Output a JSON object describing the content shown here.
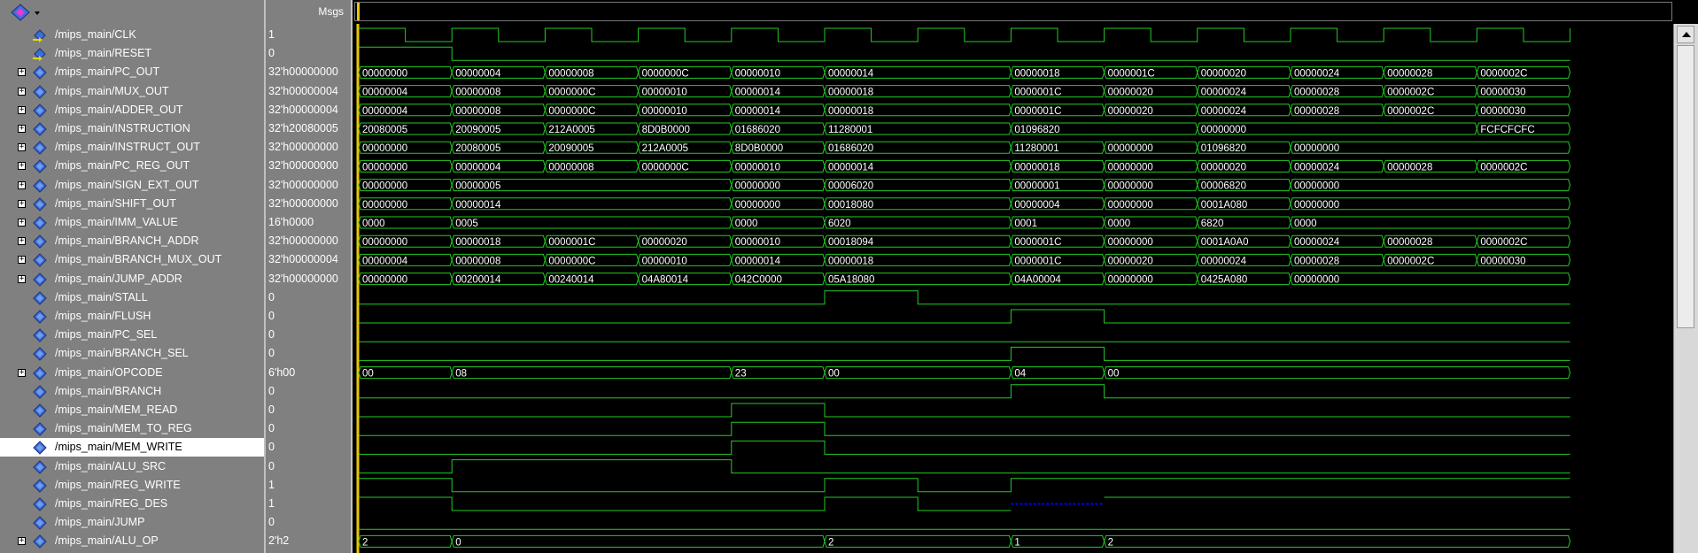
{
  "header": {
    "msgs_label": "Msgs"
  },
  "colors": {
    "wave": "#22cc22",
    "background": "#000000",
    "cursor": "#e8c800",
    "pane": "#808080",
    "highlight": "#0000ff"
  },
  "signals": [
    {
      "name": "/mips_main/CLK",
      "value": "1",
      "kind": "input",
      "expandable": false
    },
    {
      "name": "/mips_main/RESET",
      "value": "0",
      "kind": "input",
      "expandable": false
    },
    {
      "name": "/mips_main/PC_OUT",
      "value": "32'h00000000",
      "kind": "bus",
      "expandable": true
    },
    {
      "name": "/mips_main/MUX_OUT",
      "value": "32'h00000004",
      "kind": "bus",
      "expandable": true
    },
    {
      "name": "/mips_main/ADDER_OUT",
      "value": "32'h00000004",
      "kind": "bus",
      "expandable": true
    },
    {
      "name": "/mips_main/INSTRUCTION",
      "value": "32'h20080005",
      "kind": "bus",
      "expandable": true
    },
    {
      "name": "/mips_main/INSTRUCT_OUT",
      "value": "32'h00000000",
      "kind": "bus",
      "expandable": true
    },
    {
      "name": "/mips_main/PC_REG_OUT",
      "value": "32'h00000000",
      "kind": "bus",
      "expandable": true
    },
    {
      "name": "/mips_main/SIGN_EXT_OUT",
      "value": "32'h00000000",
      "kind": "bus",
      "expandable": true
    },
    {
      "name": "/mips_main/SHIFT_OUT",
      "value": "32'h00000000",
      "kind": "bus",
      "expandable": true
    },
    {
      "name": "/mips_main/IMM_VALUE",
      "value": "16'h0000",
      "kind": "bus",
      "expandable": true
    },
    {
      "name": "/mips_main/BRANCH_ADDR",
      "value": "32'h00000000",
      "kind": "bus",
      "expandable": true
    },
    {
      "name": "/mips_main/BRANCH_MUX_OUT",
      "value": "32'h00000004",
      "kind": "bus",
      "expandable": true
    },
    {
      "name": "/mips_main/JUMP_ADDR",
      "value": "32'h00000000",
      "kind": "bus",
      "expandable": true
    },
    {
      "name": "/mips_main/STALL",
      "value": "0",
      "kind": "bit",
      "expandable": false
    },
    {
      "name": "/mips_main/FLUSH",
      "value": "0",
      "kind": "bit",
      "expandable": false
    },
    {
      "name": "/mips_main/PC_SEL",
      "value": "0",
      "kind": "bit",
      "expandable": false
    },
    {
      "name": "/mips_main/BRANCH_SEL",
      "value": "0",
      "kind": "bit",
      "expandable": false
    },
    {
      "name": "/mips_main/OPCODE",
      "value": "6'h00",
      "kind": "bus",
      "expandable": true
    },
    {
      "name": "/mips_main/BRANCH",
      "value": "0",
      "kind": "bit",
      "expandable": false
    },
    {
      "name": "/mips_main/MEM_READ",
      "value": "0",
      "kind": "bit",
      "expandable": false
    },
    {
      "name": "/mips_main/MEM_TO_REG",
      "value": "0",
      "kind": "bit",
      "expandable": false
    },
    {
      "name": "/mips_main/MEM_WRITE",
      "value": "0",
      "kind": "bit",
      "expandable": false,
      "selected": true
    },
    {
      "name": "/mips_main/ALU_SRC",
      "value": "0",
      "kind": "bit",
      "expandable": false
    },
    {
      "name": "/mips_main/REG_WRITE",
      "value": "1",
      "kind": "bit",
      "expandable": false
    },
    {
      "name": "/mips_main/REG_DES",
      "value": "1",
      "kind": "bit",
      "expandable": false
    },
    {
      "name": "/mips_main/JUMP",
      "value": "0",
      "kind": "bit",
      "expandable": false
    },
    {
      "name": "/mips_main/ALU_OP",
      "value": "2'h2",
      "kind": "bus",
      "expandable": true
    }
  ],
  "waves": {
    "clock_half_periods": 26,
    "timeline_cycles": 13,
    "buses": [
      {
        "row": 2,
        "segments": [
          {
            "c": 0,
            "v": "00000000"
          },
          {
            "c": 1,
            "v": "00000004"
          },
          {
            "c": 2,
            "v": "00000008"
          },
          {
            "c": 3,
            "v": "0000000C"
          },
          {
            "c": 4,
            "v": "00000010"
          },
          {
            "c": 5,
            "v": "00000014"
          },
          {
            "c": 7,
            "v": "00000018"
          },
          {
            "c": 8,
            "v": "0000001C"
          },
          {
            "c": 9,
            "v": "00000020"
          },
          {
            "c": 10,
            "v": "00000024"
          },
          {
            "c": 11,
            "v": "00000028"
          },
          {
            "c": 12,
            "v": "0000002C"
          }
        ]
      },
      {
        "row": 3,
        "segments": [
          {
            "c": 0,
            "v": "00000004"
          },
          {
            "c": 1,
            "v": "00000008"
          },
          {
            "c": 2,
            "v": "0000000C"
          },
          {
            "c": 3,
            "v": "00000010"
          },
          {
            "c": 4,
            "v": "00000014"
          },
          {
            "c": 5,
            "v": "00000018"
          },
          {
            "c": 7,
            "v": "0000001C"
          },
          {
            "c": 8,
            "v": "00000020"
          },
          {
            "c": 9,
            "v": "00000024"
          },
          {
            "c": 10,
            "v": "00000028"
          },
          {
            "c": 11,
            "v": "0000002C"
          },
          {
            "c": 12,
            "v": "00000030"
          }
        ]
      },
      {
        "row": 4,
        "segments": [
          {
            "c": 0,
            "v": "00000004"
          },
          {
            "c": 1,
            "v": "00000008"
          },
          {
            "c": 2,
            "v": "0000000C"
          },
          {
            "c": 3,
            "v": "00000010"
          },
          {
            "c": 4,
            "v": "00000014"
          },
          {
            "c": 5,
            "v": "00000018"
          },
          {
            "c": 7,
            "v": "0000001C"
          },
          {
            "c": 8,
            "v": "00000020"
          },
          {
            "c": 9,
            "v": "00000024"
          },
          {
            "c": 10,
            "v": "00000028"
          },
          {
            "c": 11,
            "v": "0000002C"
          },
          {
            "c": 12,
            "v": "00000030"
          }
        ]
      },
      {
        "row": 5,
        "segments": [
          {
            "c": 0,
            "v": "20080005"
          },
          {
            "c": 1,
            "v": "20090005"
          },
          {
            "c": 2,
            "v": "212A0005"
          },
          {
            "c": 3,
            "v": "8D0B0000"
          },
          {
            "c": 4,
            "v": "01686020"
          },
          {
            "c": 5,
            "v": "11280001"
          },
          {
            "c": 7,
            "v": "01096820"
          },
          {
            "c": 9,
            "v": "00000000"
          },
          {
            "c": 12,
            "v": "FCFCFCFC"
          }
        ]
      },
      {
        "row": 6,
        "segments": [
          {
            "c": 0,
            "v": "00000000"
          },
          {
            "c": 1,
            "v": "20080005"
          },
          {
            "c": 2,
            "v": "20090005"
          },
          {
            "c": 3,
            "v": "212A0005"
          },
          {
            "c": 4,
            "v": "8D0B0000"
          },
          {
            "c": 5,
            "v": "01686020"
          },
          {
            "c": 7,
            "v": "11280001"
          },
          {
            "c": 8,
            "v": "00000000"
          },
          {
            "c": 9,
            "v": "01096820"
          },
          {
            "c": 10,
            "v": "00000000"
          }
        ]
      },
      {
        "row": 7,
        "segments": [
          {
            "c": 0,
            "v": "00000000"
          },
          {
            "c": 1,
            "v": "00000004"
          },
          {
            "c": 2,
            "v": "00000008"
          },
          {
            "c": 3,
            "v": "0000000C"
          },
          {
            "c": 4,
            "v": "00000010"
          },
          {
            "c": 5,
            "v": "00000014"
          },
          {
            "c": 7,
            "v": "00000018"
          },
          {
            "c": 8,
            "v": "00000000"
          },
          {
            "c": 9,
            "v": "00000020"
          },
          {
            "c": 10,
            "v": "00000024"
          },
          {
            "c": 11,
            "v": "00000028"
          },
          {
            "c": 12,
            "v": "0000002C"
          }
        ]
      },
      {
        "row": 8,
        "segments": [
          {
            "c": 0,
            "v": "00000000"
          },
          {
            "c": 1,
            "v": "00000005"
          },
          {
            "c": 4,
            "v": "00000000"
          },
          {
            "c": 5,
            "v": "00006020"
          },
          {
            "c": 7,
            "v": "00000001"
          },
          {
            "c": 8,
            "v": "00000000"
          },
          {
            "c": 9,
            "v": "00006820"
          },
          {
            "c": 10,
            "v": "00000000"
          }
        ]
      },
      {
        "row": 9,
        "segments": [
          {
            "c": 0,
            "v": "00000000"
          },
          {
            "c": 1,
            "v": "00000014"
          },
          {
            "c": 4,
            "v": "00000000"
          },
          {
            "c": 5,
            "v": "00018080"
          },
          {
            "c": 7,
            "v": "00000004"
          },
          {
            "c": 8,
            "v": "00000000"
          },
          {
            "c": 9,
            "v": "0001A080"
          },
          {
            "c": 10,
            "v": "00000000"
          }
        ]
      },
      {
        "row": 10,
        "segments": [
          {
            "c": 0,
            "v": "0000"
          },
          {
            "c": 1,
            "v": "0005"
          },
          {
            "c": 4,
            "v": "0000"
          },
          {
            "c": 5,
            "v": "6020"
          },
          {
            "c": 7,
            "v": "0001"
          },
          {
            "c": 8,
            "v": "0000"
          },
          {
            "c": 9,
            "v": "6820"
          },
          {
            "c": 10,
            "v": "0000"
          }
        ]
      },
      {
        "row": 11,
        "segments": [
          {
            "c": 0,
            "v": "00000000"
          },
          {
            "c": 1,
            "v": "00000018"
          },
          {
            "c": 2,
            "v": "0000001C"
          },
          {
            "c": 3,
            "v": "00000020"
          },
          {
            "c": 4,
            "v": "00000010"
          },
          {
            "c": 5,
            "v": "00018094"
          },
          {
            "c": 7,
            "v": "0000001C"
          },
          {
            "c": 8,
            "v": "00000000"
          },
          {
            "c": 9,
            "v": "0001A0A0"
          },
          {
            "c": 10,
            "v": "00000024"
          },
          {
            "c": 11,
            "v": "00000028"
          },
          {
            "c": 12,
            "v": "0000002C"
          }
        ]
      },
      {
        "row": 12,
        "segments": [
          {
            "c": 0,
            "v": "00000004"
          },
          {
            "c": 1,
            "v": "00000008"
          },
          {
            "c": 2,
            "v": "0000000C"
          },
          {
            "c": 3,
            "v": "00000010"
          },
          {
            "c": 4,
            "v": "00000014"
          },
          {
            "c": 5,
            "v": "00000018"
          },
          {
            "c": 7,
            "v": "0000001C"
          },
          {
            "c": 8,
            "v": "00000020"
          },
          {
            "c": 9,
            "v": "00000024"
          },
          {
            "c": 10,
            "v": "00000028"
          },
          {
            "c": 11,
            "v": "0000002C"
          },
          {
            "c": 12,
            "v": "00000030"
          }
        ]
      },
      {
        "row": 13,
        "segments": [
          {
            "c": 0,
            "v": "00000000"
          },
          {
            "c": 1,
            "v": "00200014"
          },
          {
            "c": 2,
            "v": "00240014"
          },
          {
            "c": 3,
            "v": "04A80014"
          },
          {
            "c": 4,
            "v": "042C0000"
          },
          {
            "c": 5,
            "v": "05A18080"
          },
          {
            "c": 7,
            "v": "04A00004"
          },
          {
            "c": 8,
            "v": "00000000"
          },
          {
            "c": 9,
            "v": "0425A080"
          },
          {
            "c": 10,
            "v": "00000000"
          }
        ]
      },
      {
        "row": 18,
        "segments": [
          {
            "c": 0,
            "v": "00"
          },
          {
            "c": 1,
            "v": "08"
          },
          {
            "c": 4,
            "v": "23"
          },
          {
            "c": 5,
            "v": "00"
          },
          {
            "c": 7,
            "v": "04"
          },
          {
            "c": 8,
            "v": "00"
          }
        ]
      },
      {
        "row": 27,
        "segments": [
          {
            "c": 0,
            "v": "2"
          },
          {
            "c": 1,
            "v": "0"
          },
          {
            "c": 5,
            "v": "2"
          },
          {
            "c": 7,
            "v": "1"
          },
          {
            "c": 8,
            "v": "2"
          }
        ]
      }
    ],
    "bits": [
      {
        "row": 1,
        "levels": [
          1,
          0,
          0,
          0,
          0,
          0,
          0,
          0,
          0,
          0,
          0,
          0,
          0
        ]
      },
      {
        "row": 14,
        "levels": [
          0,
          0,
          0,
          0,
          0,
          1,
          0,
          0,
          0,
          0,
          0,
          0,
          0
        ]
      },
      {
        "row": 15,
        "levels": [
          0,
          0,
          0,
          0,
          0,
          0,
          0,
          1,
          0,
          0,
          0,
          0,
          0
        ]
      },
      {
        "row": 16,
        "levels": [
          0,
          0,
          0,
          0,
          0,
          0,
          0,
          0,
          0,
          0,
          0,
          0,
          0
        ]
      },
      {
        "row": 17,
        "levels": [
          0,
          0,
          0,
          0,
          0,
          0,
          0,
          1,
          0,
          0,
          0,
          0,
          0
        ]
      },
      {
        "row": 19,
        "levels": [
          0,
          0,
          0,
          0,
          0,
          0,
          0,
          1,
          0,
          0,
          0,
          0,
          0
        ]
      },
      {
        "row": 20,
        "levels": [
          0,
          0,
          0,
          0,
          1,
          0,
          0,
          0,
          0,
          0,
          0,
          0,
          0
        ]
      },
      {
        "row": 21,
        "levels": [
          0,
          0,
          0,
          0,
          1,
          0,
          0,
          0,
          0,
          0,
          0,
          0,
          0
        ]
      },
      {
        "row": 22,
        "levels": [
          0,
          0,
          0,
          0,
          1,
          0,
          0,
          0,
          0,
          0,
          0,
          0,
          0
        ]
      },
      {
        "row": 23,
        "levels": [
          0,
          1,
          1,
          1,
          0,
          0,
          0,
          0,
          0,
          0,
          0,
          0,
          0
        ]
      },
      {
        "row": 24,
        "levels": [
          1,
          0,
          0,
          0,
          0,
          1,
          0,
          1,
          1,
          1,
          1,
          1,
          1
        ]
      },
      {
        "row": 25,
        "levels": [
          1,
          0,
          0,
          0,
          0,
          1,
          0,
          2,
          1,
          1,
          1,
          1,
          1
        ]
      },
      {
        "row": 26,
        "levels": [
          0,
          0,
          0,
          0,
          0,
          0,
          0,
          0,
          0,
          0,
          0,
          0,
          0
        ]
      }
    ]
  }
}
